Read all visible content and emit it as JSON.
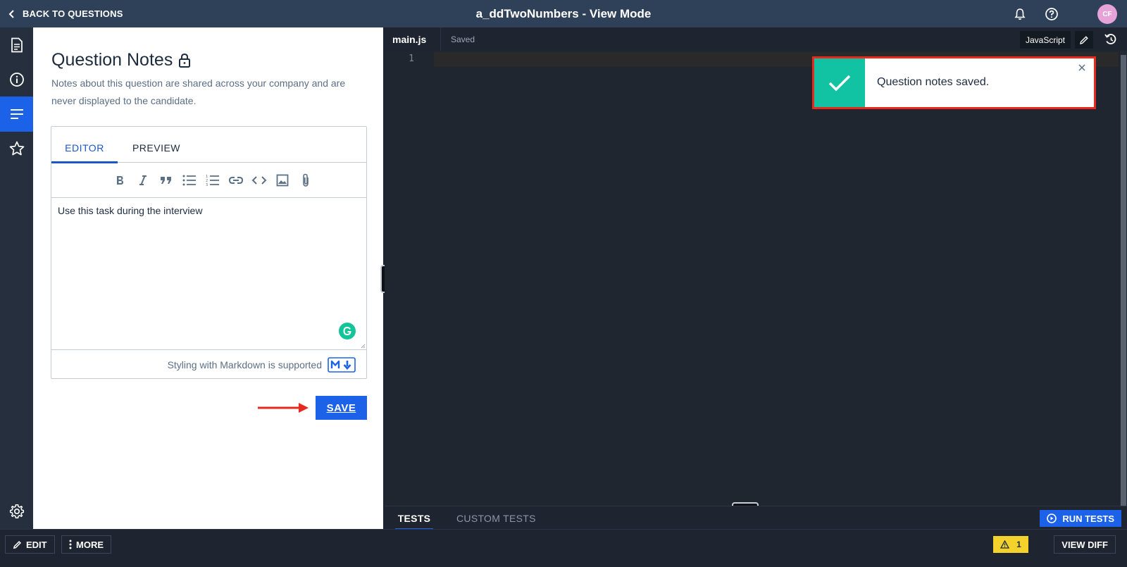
{
  "header": {
    "back_label": "BACK TO QUESTIONS",
    "title": "a_ddTwoNumbers - View Mode",
    "avatar_initials": "CF"
  },
  "rail": {
    "items": [
      {
        "icon": "document-icon"
      },
      {
        "icon": "info-icon"
      },
      {
        "icon": "notes-icon",
        "active": true
      },
      {
        "icon": "star-icon"
      },
      {
        "icon": "gear-icon"
      }
    ],
    "accent_color": "#1b62e8"
  },
  "notes": {
    "title": "Question Notes",
    "description": "Notes about this question are shared across your company and are never displayed to the candidate.",
    "tabs": {
      "editor": "EDITOR",
      "preview": "PREVIEW"
    },
    "toolbar": [
      "bold-icon",
      "italic-icon",
      "quote-icon",
      "bullet-list-icon",
      "numbered-list-icon",
      "link-icon",
      "code-icon",
      "image-icon",
      "attachment-icon"
    ],
    "content": "Use this task during the interview",
    "markdown_hint": "Styling with Markdown is supported",
    "save_label": "SAVE"
  },
  "code": {
    "filename": "main.js",
    "status": "Saved",
    "language": "JavaScript",
    "line_numbers": [
      "1"
    ]
  },
  "toast": {
    "message": "Question notes saved.",
    "accent_color": "#12c3a3",
    "highlight_color": "#e8291e"
  },
  "tests": {
    "tabs": [
      "TESTS",
      "CUSTOM TESTS"
    ],
    "run_label": "RUN TESTS"
  },
  "footer": {
    "edit_label": "EDIT",
    "more_label": "MORE",
    "warning_count": "1",
    "view_diff_label": "VIEW DIFF"
  }
}
